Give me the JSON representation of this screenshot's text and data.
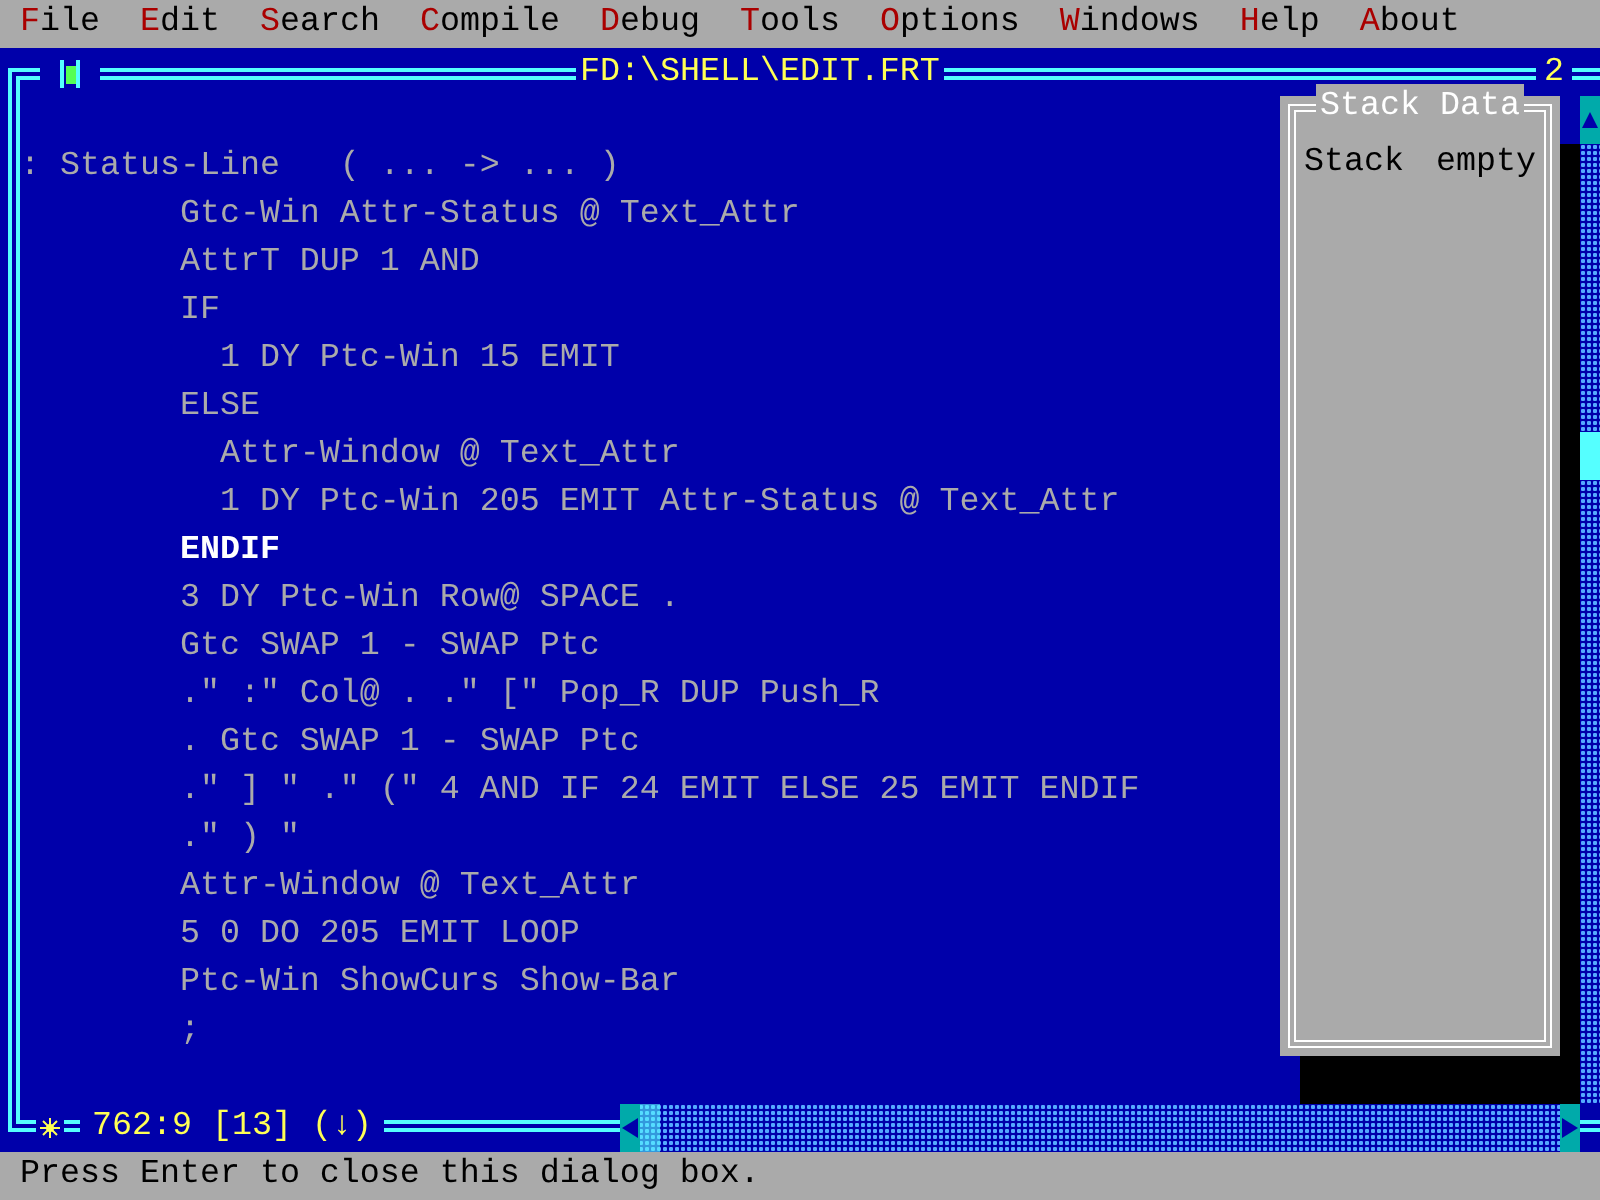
{
  "menu": [
    {
      "hotkey": "F",
      "label": "ile"
    },
    {
      "hotkey": "E",
      "label": "dit"
    },
    {
      "hotkey": "S",
      "label": "earch"
    },
    {
      "hotkey": "C",
      "label": "ompile"
    },
    {
      "hotkey": "D",
      "label": "ebug"
    },
    {
      "hotkey": "T",
      "label": "ools"
    },
    {
      "hotkey": "O",
      "label": "ptions"
    },
    {
      "hotkey": "W",
      "label": "indows"
    },
    {
      "hotkey": "H",
      "label": "elp"
    },
    {
      "hotkey": "A",
      "label": "bout"
    }
  ],
  "editor": {
    "title": "FD:\\SHELL\\EDIT.FRT",
    "number": "2",
    "position": "762:9 [13] (↓)",
    "lines": [
      {
        "text": ": Status-Line   ( ... -> ... )",
        "highlighted": false
      },
      {
        "text": "        Gtc-Win Attr-Status @ Text_Attr",
        "highlighted": false
      },
      {
        "text": "        AttrT DUP 1 AND",
        "highlighted": false
      },
      {
        "text": "        IF",
        "highlighted": false
      },
      {
        "text": "          1 DY Ptc-Win 15 EMIT",
        "highlighted": false
      },
      {
        "text": "        ELSE",
        "highlighted": false
      },
      {
        "text": "          Attr-Window @ Text_Attr",
        "highlighted": false
      },
      {
        "text": "          1 DY Ptc-Win 205 EMIT Attr-Status @ Text_Attr",
        "highlighted": false
      },
      {
        "text": "        ENDIF",
        "highlighted": true
      },
      {
        "text": "        3 DY Ptc-Win Row@ SPACE .",
        "highlighted": false
      },
      {
        "text": "        Gtc SWAP 1 - SWAP Ptc",
        "highlighted": false
      },
      {
        "text": "        .\" :\" Col@ . .\" [\" Pop_R DUP Push_R",
        "highlighted": false
      },
      {
        "text": "        . Gtc SWAP 1 - SWAP Ptc",
        "highlighted": false
      },
      {
        "text": "        .\" ] \" .\" (\" 4 AND IF 24 EMIT ELSE 25 EMIT ENDIF",
        "highlighted": false
      },
      {
        "text": "        .\" ) \"",
        "highlighted": false
      },
      {
        "text": "        Attr-Window @ Text_Attr",
        "highlighted": false
      },
      {
        "text": "        5 0 DO 205 EMIT LOOP",
        "highlighted": false
      },
      {
        "text": "        Ptc-Win ShowCurs Show-Bar",
        "highlighted": false
      },
      {
        "text": "        ;",
        "highlighted": false
      }
    ]
  },
  "stack_panel": {
    "title": "Stack Data",
    "label": "Stack",
    "value": "empty"
  },
  "status_bar": "Press Enter to close this dialog box."
}
